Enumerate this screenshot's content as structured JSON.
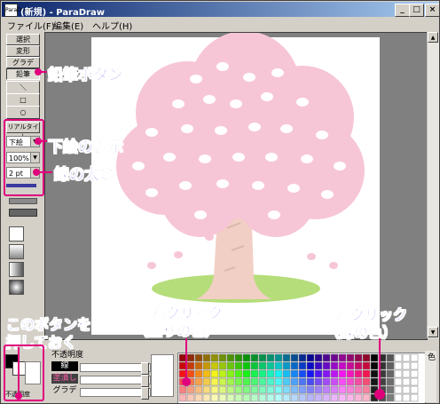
{
  "window": {
    "title": "(新規) - ParaDraw",
    "icon_text": "ParaDraw"
  },
  "caption_buttons": {
    "minimize": "_",
    "maximize": "□",
    "close": "×"
  },
  "menu": [
    "ファイル(F)",
    "編集(E)",
    "ヘルプ(H)"
  ],
  "tools": [
    "選択",
    "変形",
    "グラデ",
    "鉛筆"
  ],
  "shape_tools": [
    "＼",
    "□",
    "○"
  ],
  "real_label": "リアルタイム",
  "underlay_combo": "下絵",
  "zoom_combo": "100%",
  "stroke_combo": "2 pt",
  "opacity": {
    "title": "不透明度",
    "rows": [
      {
        "label": "線",
        "value": "255",
        "level": 1.0
      },
      {
        "label": "塗潰し",
        "value": "255",
        "level": 1.0
      },
      {
        "label": "グラデ",
        "value": "255",
        "level": 1.0
      }
    ]
  },
  "color_well_label": "不透明度",
  "palette_label": "色",
  "annotations": {
    "pencil": "鉛筆ボタン",
    "underlay": "下絵の表示",
    "thickness": "線の太さ",
    "keep_pressed_1": "このボタンを",
    "keep_pressed_2": "押しておく",
    "right_click_1": "右クリック",
    "right_click_2": "（塗りの色）",
    "left_click_1": "左クリック",
    "left_click_2": "（線の色）"
  },
  "colors": {
    "blossom": "#f7c6d6",
    "trunk": "#f2cfc4",
    "grass": "#b5dd7a",
    "annotation": "#1e1ed8",
    "marker": "#e0007c"
  }
}
